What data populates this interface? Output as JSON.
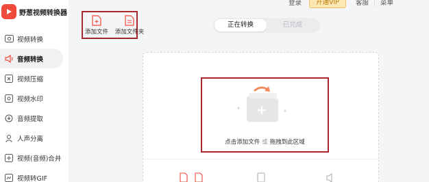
{
  "app": {
    "title": "野葱视频转换器"
  },
  "topbar": {
    "login": "登录",
    "vip": "开通VIP",
    "service": "客服",
    "menu": "菜单"
  },
  "toolbar": {
    "add_file": "添加文件",
    "add_folder": "添加文件夹"
  },
  "tabs": [
    {
      "label": "正在转换"
    },
    {
      "label": "已完成"
    }
  ],
  "sidebar": {
    "items": [
      {
        "label": "视频转换",
        "icon": "video-convert-icon"
      },
      {
        "label": "音频转换",
        "icon": "audio-convert-icon"
      },
      {
        "label": "视频压缩",
        "icon": "video-compress-icon"
      },
      {
        "label": "视频水印",
        "icon": "watermark-icon"
      },
      {
        "label": "音频提取",
        "icon": "audio-extract-icon"
      },
      {
        "label": "人声分离",
        "icon": "voice-separate-icon"
      },
      {
        "label": "视频(音频)合并",
        "icon": "merge-icon"
      },
      {
        "label": "视频转GIF",
        "icon": "gif-icon"
      }
    ]
  },
  "dropzone": {
    "click_text": "点击添加文件",
    "or_text": "或",
    "drag_text": "拖拽到此区域"
  },
  "colors": {
    "accent": "#ef4a3c",
    "highlight_border": "#a8262c",
    "vip_bg": "#fde7b3"
  }
}
